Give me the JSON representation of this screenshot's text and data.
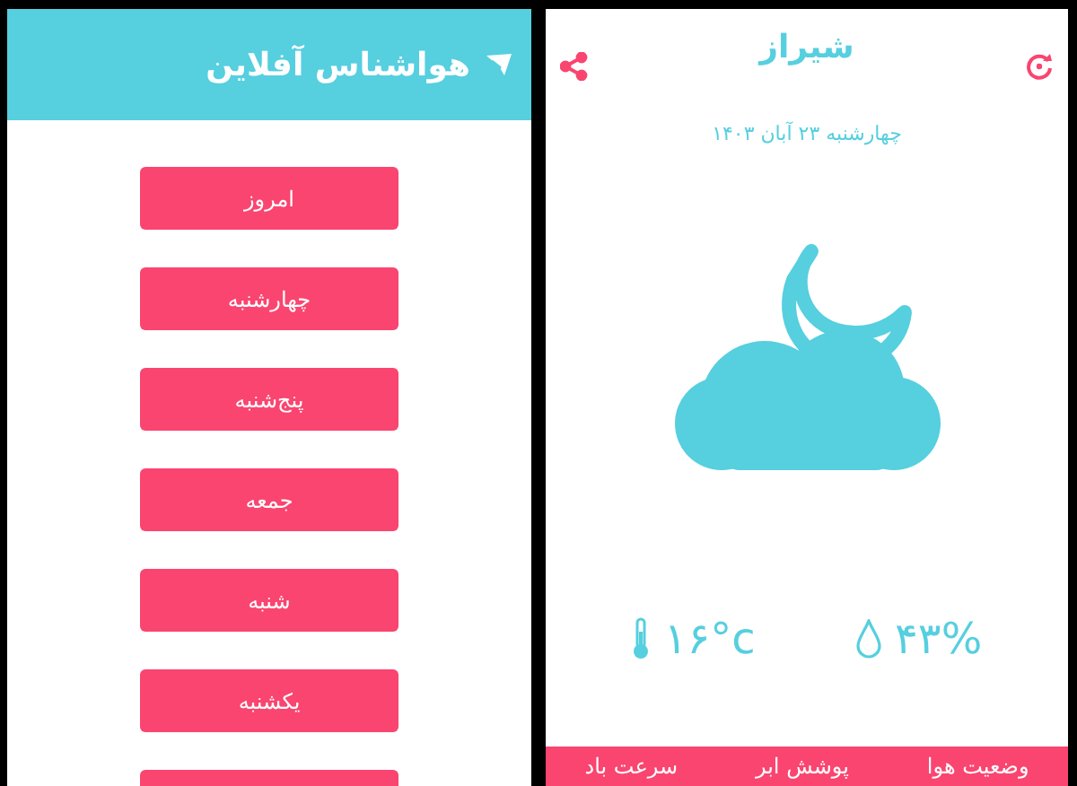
{
  "menu_screen": {
    "title": "هواشناس آفلاین",
    "days": [
      {
        "label": "امروز"
      },
      {
        "label": "چهارشنبه"
      },
      {
        "label": "پنج‌شنبه"
      },
      {
        "label": "جمعه"
      },
      {
        "label": "شنبه"
      },
      {
        "label": "یکشنبه"
      }
    ]
  },
  "weather_screen": {
    "city": "شیراز",
    "date": "چهارشنبه ۲۳ آبان ۱۴۰۳",
    "temperature": "۱۶°c",
    "humidity": "۴۳%",
    "tabs": [
      {
        "label": "وضعیت هوا"
      },
      {
        "label": "پوشش ابر"
      },
      {
        "label": "سرعت باد"
      }
    ]
  }
}
